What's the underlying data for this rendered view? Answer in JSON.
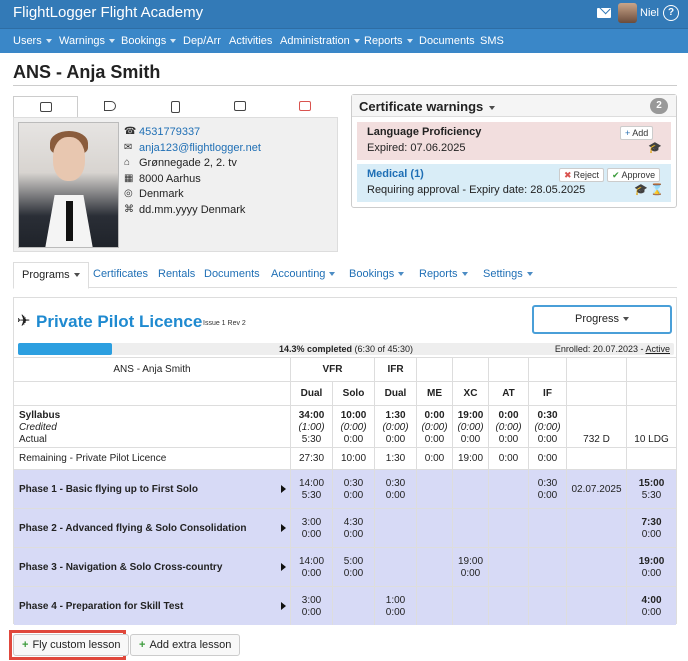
{
  "app": {
    "title": "FlightLogger Flight Academy",
    "user": "Niel",
    "help": "?"
  },
  "nav": [
    {
      "label": "Users",
      "caret": true
    },
    {
      "label": "Warnings",
      "caret": true
    },
    {
      "label": "Bookings",
      "caret": true
    },
    {
      "label": "Dep/Arr",
      "caret": false
    },
    {
      "label": "Activities",
      "caret": false
    },
    {
      "label": "Administration",
      "caret": true
    },
    {
      "label": "Reports",
      "caret": true
    },
    {
      "label": "Documents",
      "caret": false
    },
    {
      "label": "SMS",
      "caret": false
    }
  ],
  "page_title": "ANS - Anja Smith",
  "profile": {
    "phone": "4531779337",
    "email": "anja123@flightlogger.net",
    "address1": "Grønnegade 2, 2. tv",
    "address2": "8000 Aarhus",
    "country": "Denmark",
    "birth": "dd.mm.yyyy Denmark"
  },
  "cert_warnings": {
    "title": "Certificate warnings",
    "count": "2",
    "items": [
      {
        "name": "Language Proficiency",
        "detail": "Expired: 07.06.2025",
        "action": "Add"
      },
      {
        "name": "Medical (1)",
        "detail": "Requiring approval - Expiry date: 28.05.2025",
        "reject": "Reject",
        "approve": "Approve"
      }
    ]
  },
  "tabs": {
    "programs": "Programs",
    "certificates": "Certificates",
    "rentals": "Rentals",
    "documents": "Documents",
    "accounting": "Accounting",
    "bookings": "Bookings",
    "reports": "Reports",
    "settings": "Settings"
  },
  "program": {
    "title": "Private Pilot Licence",
    "issue": "Issue 1 Rev 2",
    "progress_button": "Progress",
    "progress_percent": 14.3,
    "completed_bold": "14.3% completed",
    "completed_rest": " (6:30 of 45:30)",
    "enrolled_label": "Enrolled: 20.07.2023 - ",
    "enrolled_status": "Active",
    "student": "ANS - Anja Smith",
    "groups": {
      "vfr": "VFR",
      "ifr": "IFR"
    },
    "columns": [
      "Dual",
      "Solo",
      "Dual",
      "ME",
      "XC",
      "AT",
      "IF"
    ],
    "syllabus": {
      "labels": [
        "Syllabus",
        "Credited",
        "Actual"
      ],
      "values": [
        [
          "34:00",
          "(1:00)",
          "5:30"
        ],
        [
          "10:00",
          "(0:00)",
          "0:00"
        ],
        [
          "1:30",
          "(0:00)",
          "0:00"
        ],
        [
          "0:00",
          "(0:00)",
          "0:00"
        ],
        [
          "19:00",
          "(0:00)",
          "0:00"
        ],
        [
          "0:00",
          "(0:00)",
          "0:00"
        ],
        [
          "0:30",
          "(0:00)",
          "0:00"
        ]
      ],
      "days": "732 D",
      "landings": "10 LDG"
    },
    "remaining": {
      "label": "Remaining - Private Pilot Licence",
      "values": [
        "27:30",
        "10:00",
        "1:30",
        "0:00",
        "19:00",
        "0:00",
        "0:00"
      ]
    },
    "phases": [
      {
        "name": "Phase 1 - Basic flying up to First Solo",
        "values": [
          [
            "14:00",
            "5:30"
          ],
          [
            "0:30",
            "0:00"
          ],
          [
            "0:30",
            "0:00"
          ],
          [
            "",
            ""
          ],
          [
            "",
            ""
          ],
          [
            "",
            ""
          ],
          [
            "0:30",
            "0:00"
          ]
        ],
        "date": "02.07.2025",
        "total": [
          "15:00",
          "5:30"
        ]
      },
      {
        "name": "Phase 2 - Advanced flying & Solo Consolidation",
        "values": [
          [
            "3:00",
            "0:00"
          ],
          [
            "4:30",
            "0:00"
          ],
          [
            "",
            ""
          ],
          [
            "",
            ""
          ],
          [
            "",
            ""
          ],
          [
            "",
            ""
          ],
          [
            "",
            ""
          ]
        ],
        "date": "",
        "total": [
          "7:30",
          "0:00"
        ]
      },
      {
        "name": "Phase 3 - Navigation & Solo Cross-country",
        "values": [
          [
            "14:00",
            "0:00"
          ],
          [
            "5:00",
            "0:00"
          ],
          [
            "",
            ""
          ],
          [
            "",
            ""
          ],
          [
            "19:00",
            "0:00"
          ],
          [
            "",
            ""
          ],
          [
            "",
            ""
          ]
        ],
        "date": "",
        "total": [
          "19:00",
          "0:00"
        ]
      },
      {
        "name": "Phase 4 - Preparation for Skill Test",
        "values": [
          [
            "3:00",
            "0:00"
          ],
          [
            "",
            ""
          ],
          [
            "1:00",
            "0:00"
          ],
          [
            "",
            ""
          ],
          [
            "",
            ""
          ],
          [
            "",
            ""
          ],
          [
            "",
            ""
          ]
        ],
        "date": "",
        "total": [
          "4:00",
          "0:00"
        ]
      }
    ]
  },
  "buttons": {
    "fly_custom": "Fly custom lesson",
    "add_extra": "Add extra lesson"
  },
  "colors": {
    "brand": "#337ab7",
    "accent": "#1f8ad0",
    "phase_bg": "#d7daf6",
    "highlight": "#e0483c"
  }
}
